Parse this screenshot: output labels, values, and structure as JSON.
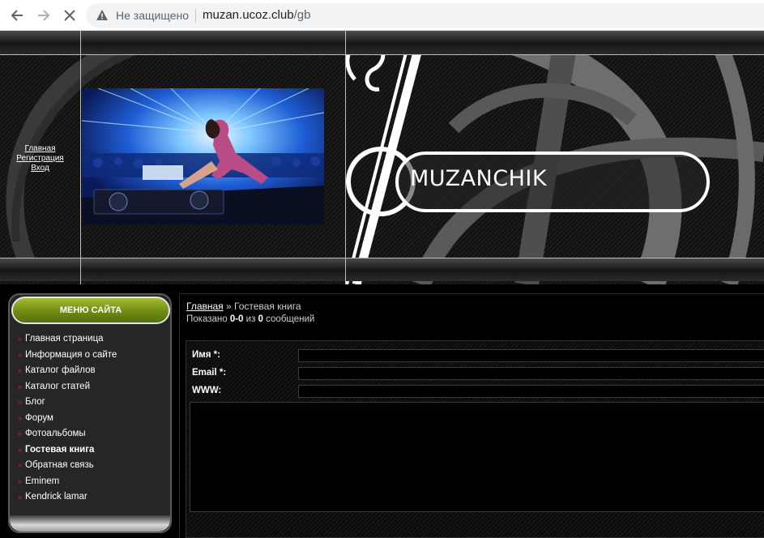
{
  "browser": {
    "security_label": "Не защищено",
    "url_domain": "muzan.ucoz.club",
    "url_path": "/gb"
  },
  "header": {
    "auth_links": [
      "Главная",
      "Регистрация",
      "Вход"
    ],
    "site_title": "MUZANCHIK"
  },
  "sidebar": {
    "menu_title": "МЕНЮ САЙТА",
    "bullet": "»",
    "items": [
      {
        "label": "Главная страница",
        "active": false
      },
      {
        "label": "Информация о сайте",
        "active": false
      },
      {
        "label": "Каталог файлов",
        "active": false
      },
      {
        "label": "Каталог статей",
        "active": false
      },
      {
        "label": "Блог",
        "active": false
      },
      {
        "label": "Форум",
        "active": false
      },
      {
        "label": "Фотоальбомы",
        "active": false
      },
      {
        "label": "Гостевая книга",
        "active": true
      },
      {
        "label": "Обратная связь",
        "active": false
      },
      {
        "label": "Eminem",
        "active": false
      },
      {
        "label": "Kendrick lamar",
        "active": false
      }
    ]
  },
  "main": {
    "breadcrumb_home": "Главная",
    "breadcrumb_sep": " » ",
    "breadcrumb_current": "Гостевая книга",
    "shown_prefix": "Показано ",
    "shown_range": "0-0",
    "shown_middle": " из ",
    "shown_total": "0",
    "shown_suffix": " сообщений"
  },
  "form": {
    "name_label": "Имя *:",
    "email_label": "Email *:",
    "www_label": "WWW:",
    "name_value": "",
    "email_value": "",
    "www_value": "",
    "message_value": ""
  },
  "colors": {
    "menu_header_green": "#7a9618",
    "bullet_red": "#cc2222",
    "page_bg": "#000000"
  }
}
